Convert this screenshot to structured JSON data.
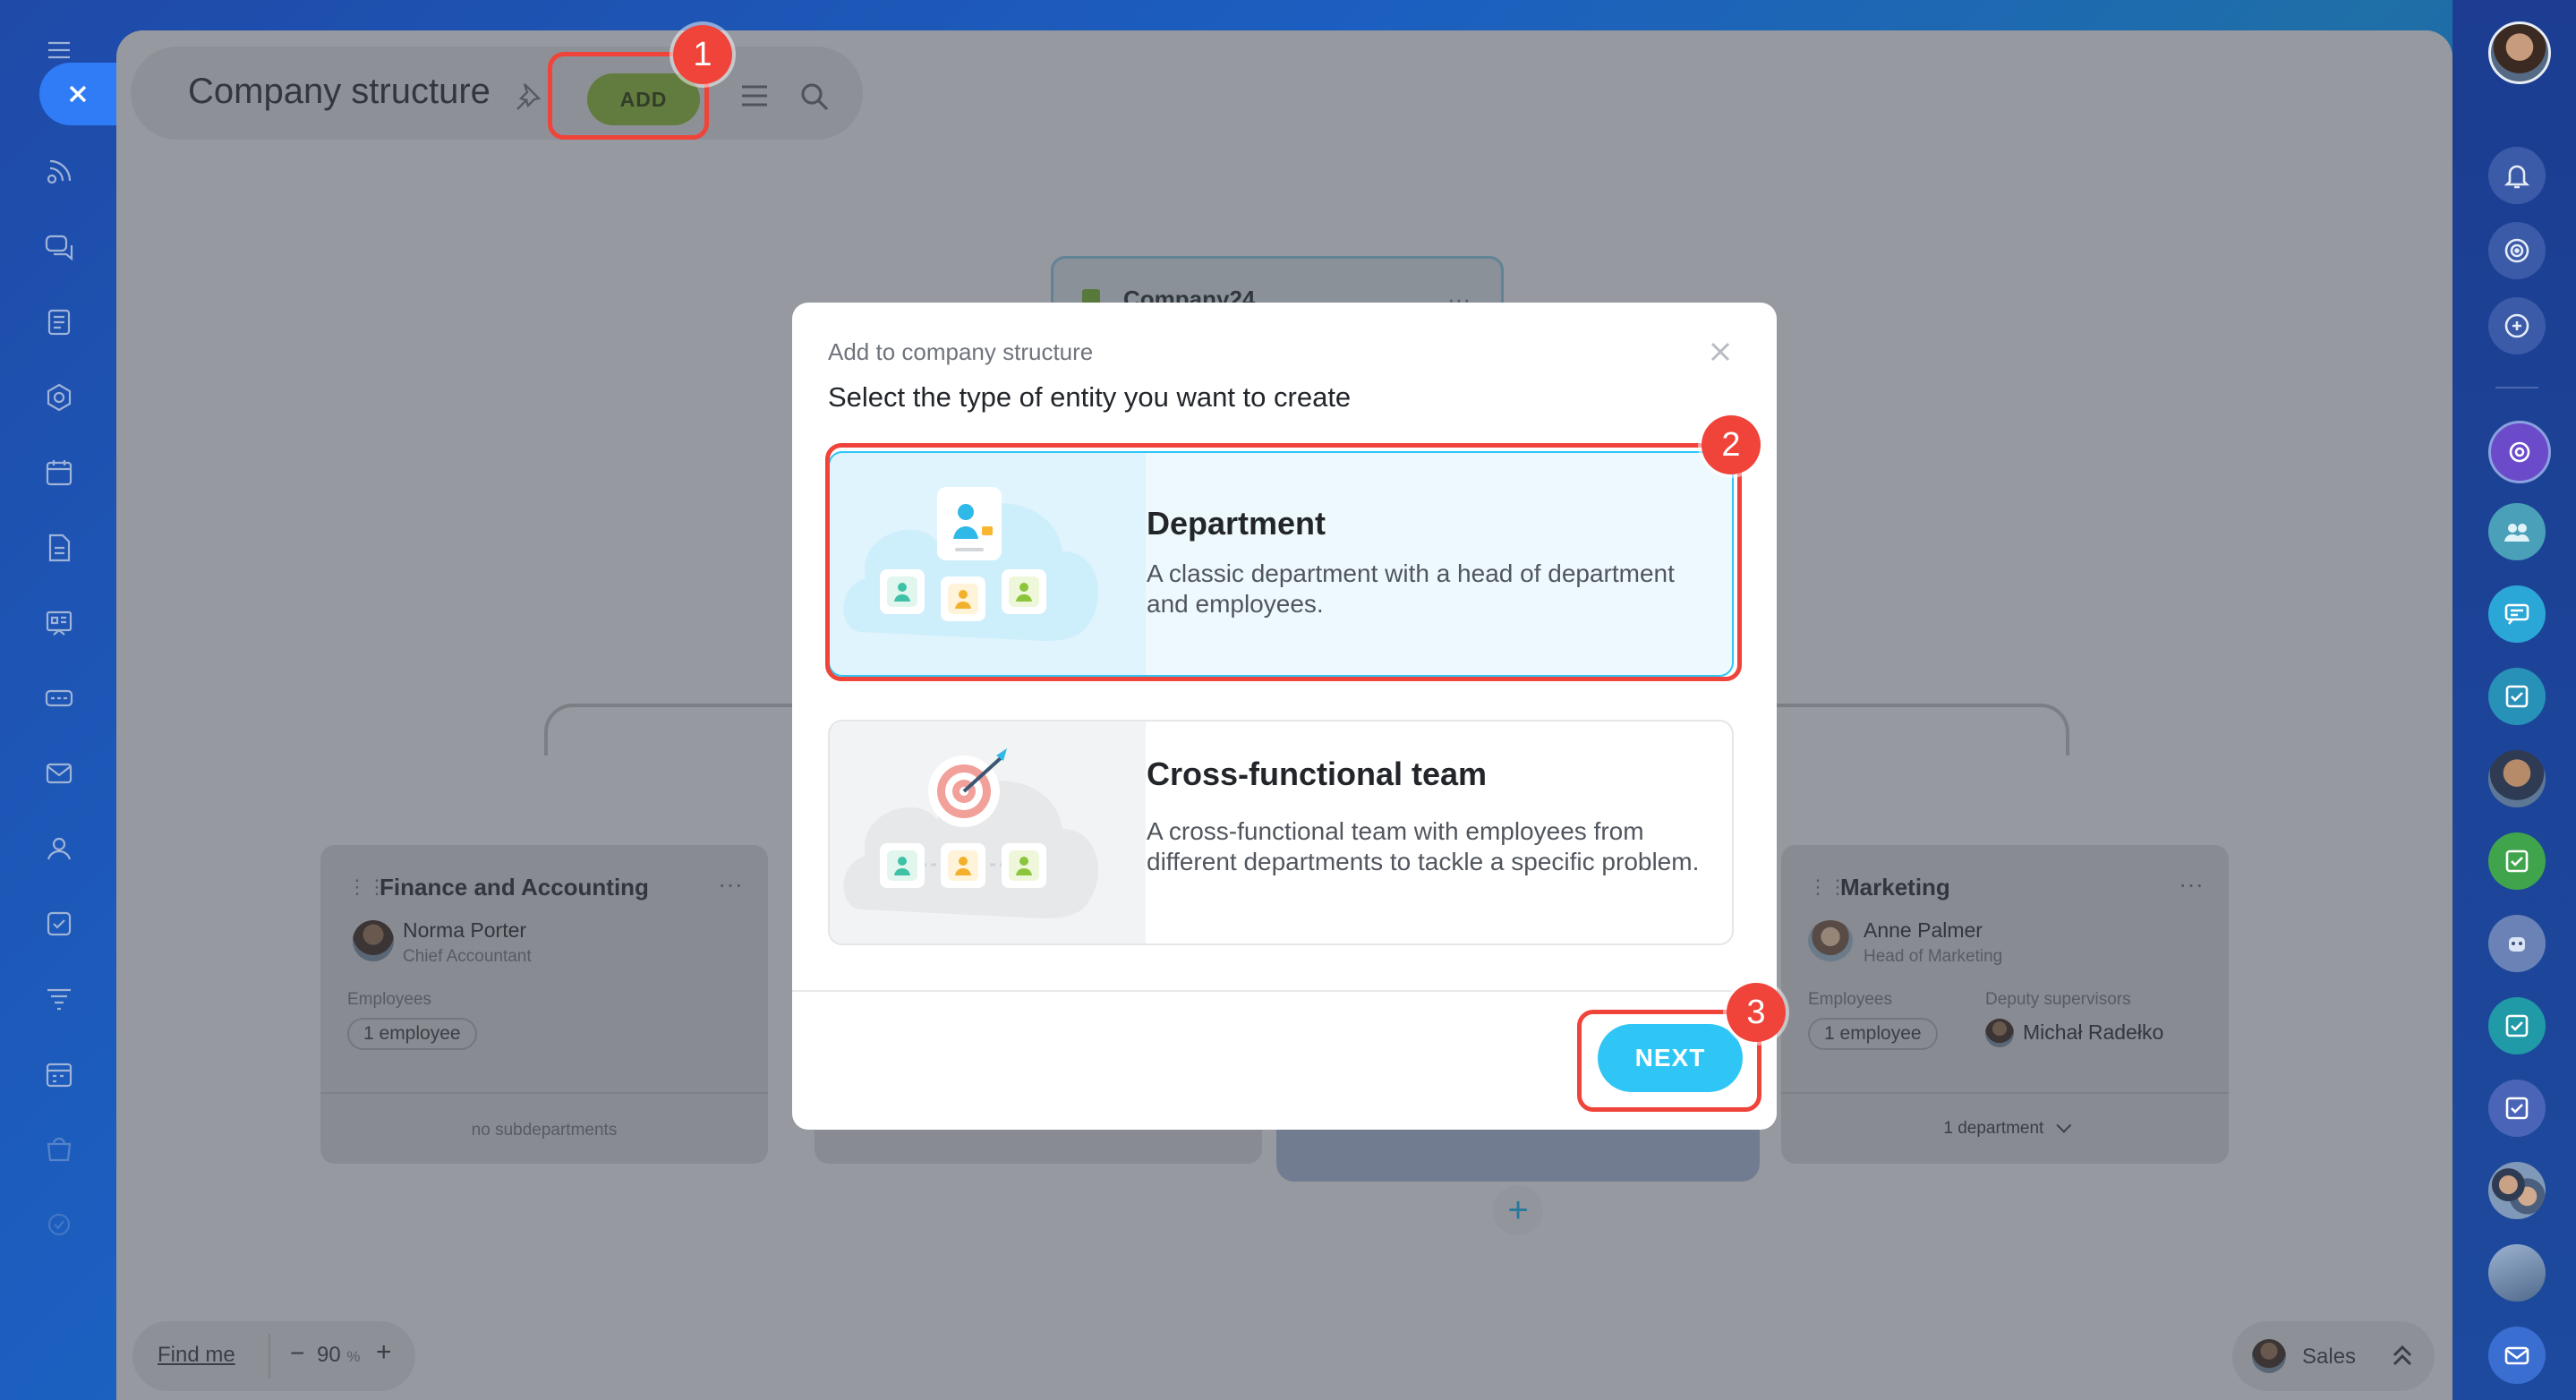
{
  "header": {
    "title": "Company structure",
    "add_label": "ADD"
  },
  "tree": {
    "root": {
      "name": "Company24"
    },
    "finance": {
      "title": "Finance and Accounting",
      "person_name": "Norma Porter",
      "person_role": "Chief Accountant",
      "employees_label": "Employees",
      "employees_count": "1 employee",
      "footer": "no subdepartments"
    },
    "marketing": {
      "title": "Marketing",
      "person_name": "Anne Palmer",
      "person_role": "Head of Marketing",
      "employees_label": "Employees",
      "employees_count": "1 employee",
      "deputy_label": "Deputy supervisors",
      "deputy_name": "Michał Radełko",
      "footer": "1 department"
    }
  },
  "zoom": {
    "find_me": "Find me",
    "minus": "−",
    "value": "90",
    "unit": "%",
    "plus": "+"
  },
  "sales_chip": {
    "label": "Sales"
  },
  "modal": {
    "caption": "Add to company structure",
    "heading": "Select the type of entity you want to create",
    "options": [
      {
        "title": "Department",
        "description": "A classic department with a head of department and employees."
      },
      {
        "title": "Cross-functional team",
        "description": "A cross-functional team with employees from different departments to tackle a specific problem."
      }
    ],
    "next_label": "NEXT"
  },
  "annotations": {
    "step1": "1",
    "step2": "2",
    "step3": "3"
  },
  "colors": {
    "accent_blue": "#2fc6f6",
    "add_green": "#7fa53a",
    "highlight_red": "#f0433a"
  }
}
